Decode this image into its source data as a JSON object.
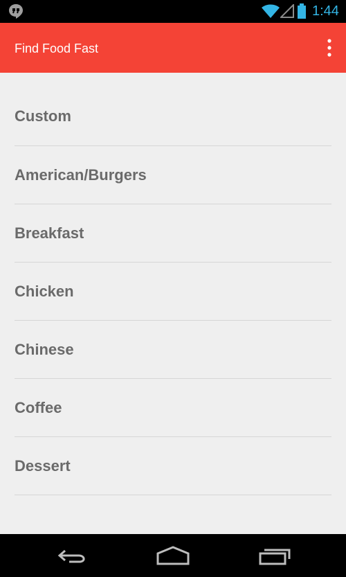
{
  "status_bar": {
    "time": "1:44",
    "icons": [
      "hangouts-icon",
      "wifi-icon",
      "signal-icon",
      "battery-icon"
    ]
  },
  "action_bar": {
    "title": "Find Food Fast",
    "background": "#f44336",
    "overflow_icon": "more-vert-icon"
  },
  "categories": [
    {
      "label": "Custom"
    },
    {
      "label": "American/Burgers"
    },
    {
      "label": "Breakfast"
    },
    {
      "label": "Chicken"
    },
    {
      "label": "Chinese"
    },
    {
      "label": "Coffee"
    },
    {
      "label": "Dessert"
    }
  ],
  "nav_bar": {
    "buttons": [
      "back-icon",
      "home-icon",
      "recents-icon"
    ]
  }
}
